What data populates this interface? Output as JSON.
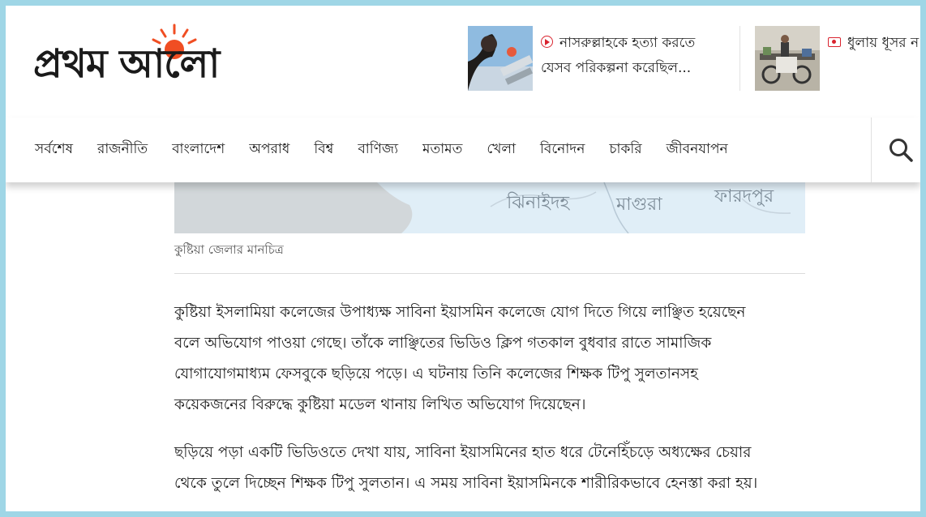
{
  "header": {
    "logo_text": "প্রথম আলো",
    "brand_color": "#f04e23",
    "cards": [
      {
        "icon": "play-icon",
        "title_lines": [
          "নাসরুল্লাহকে হত্যা করতে",
          "যেসব পরিকল্পনা করেছিল..."
        ]
      },
      {
        "icon": "camera-icon",
        "title_lines": [
          "ধুলায় ধূসর ন"
        ]
      }
    ]
  },
  "nav": {
    "items": [
      "সর্বশেষ",
      "রাজনীতি",
      "বাংলাদেশ",
      "অপরাধ",
      "বিশ্ব",
      "বাণিজ্য",
      "মতামত",
      "খেলা",
      "বিনোদন",
      "চাকরি",
      "জীবনযাপন"
    ],
    "search_icon": "search-icon"
  },
  "article": {
    "map_labels": [
      "ঝিনাইদহ",
      "মাগুরা",
      "ফারদপুর"
    ],
    "caption": "কুষ্টিয়া জেলার মানচিত্র",
    "paragraphs": [
      {
        "lines": [
          "কুষ্টিয়া ইসলামিয়া কলেজের উপাধ্যক্ষ সাবিনা ইয়াসমিন কলেজে যোগ দিতে গিয়ে লাঞ্ছিত হয়েছেন",
          "বলে অভিযোগ পাওয়া গেছে। তাঁকে লাঞ্ছিতের ভিডিও ক্লিপ গতকাল বুধবার রাতে সামাজিক",
          "যোগাযোগমাধ্যম ফেসবুকে ছড়িয়ে পড়ে। এ ঘটনায় তিনি কলেজের শিক্ষক টিপু সুলতানসহ",
          "কয়েকজনের বিরুদ্ধে কুষ্টিয়া মডেল থানায় লিখিত অভিযোগ দিয়েছেন।"
        ]
      },
      {
        "lines": [
          "ছড়িয়ে পড়া একটি ভিডিওতে দেখা যায়, সাবিনা ইয়াসমিনের হাত ধরে টেনেহিঁচড়ে অধ্যক্ষের চেয়ার",
          "থেকে তুলে দিচ্ছেন শিক্ষক টিপু সুলতান। এ সময় সাবিনা ইয়াসমিনকে শারীরিকভাবে হেনস্তা করা হয়।"
        ]
      }
    ]
  }
}
